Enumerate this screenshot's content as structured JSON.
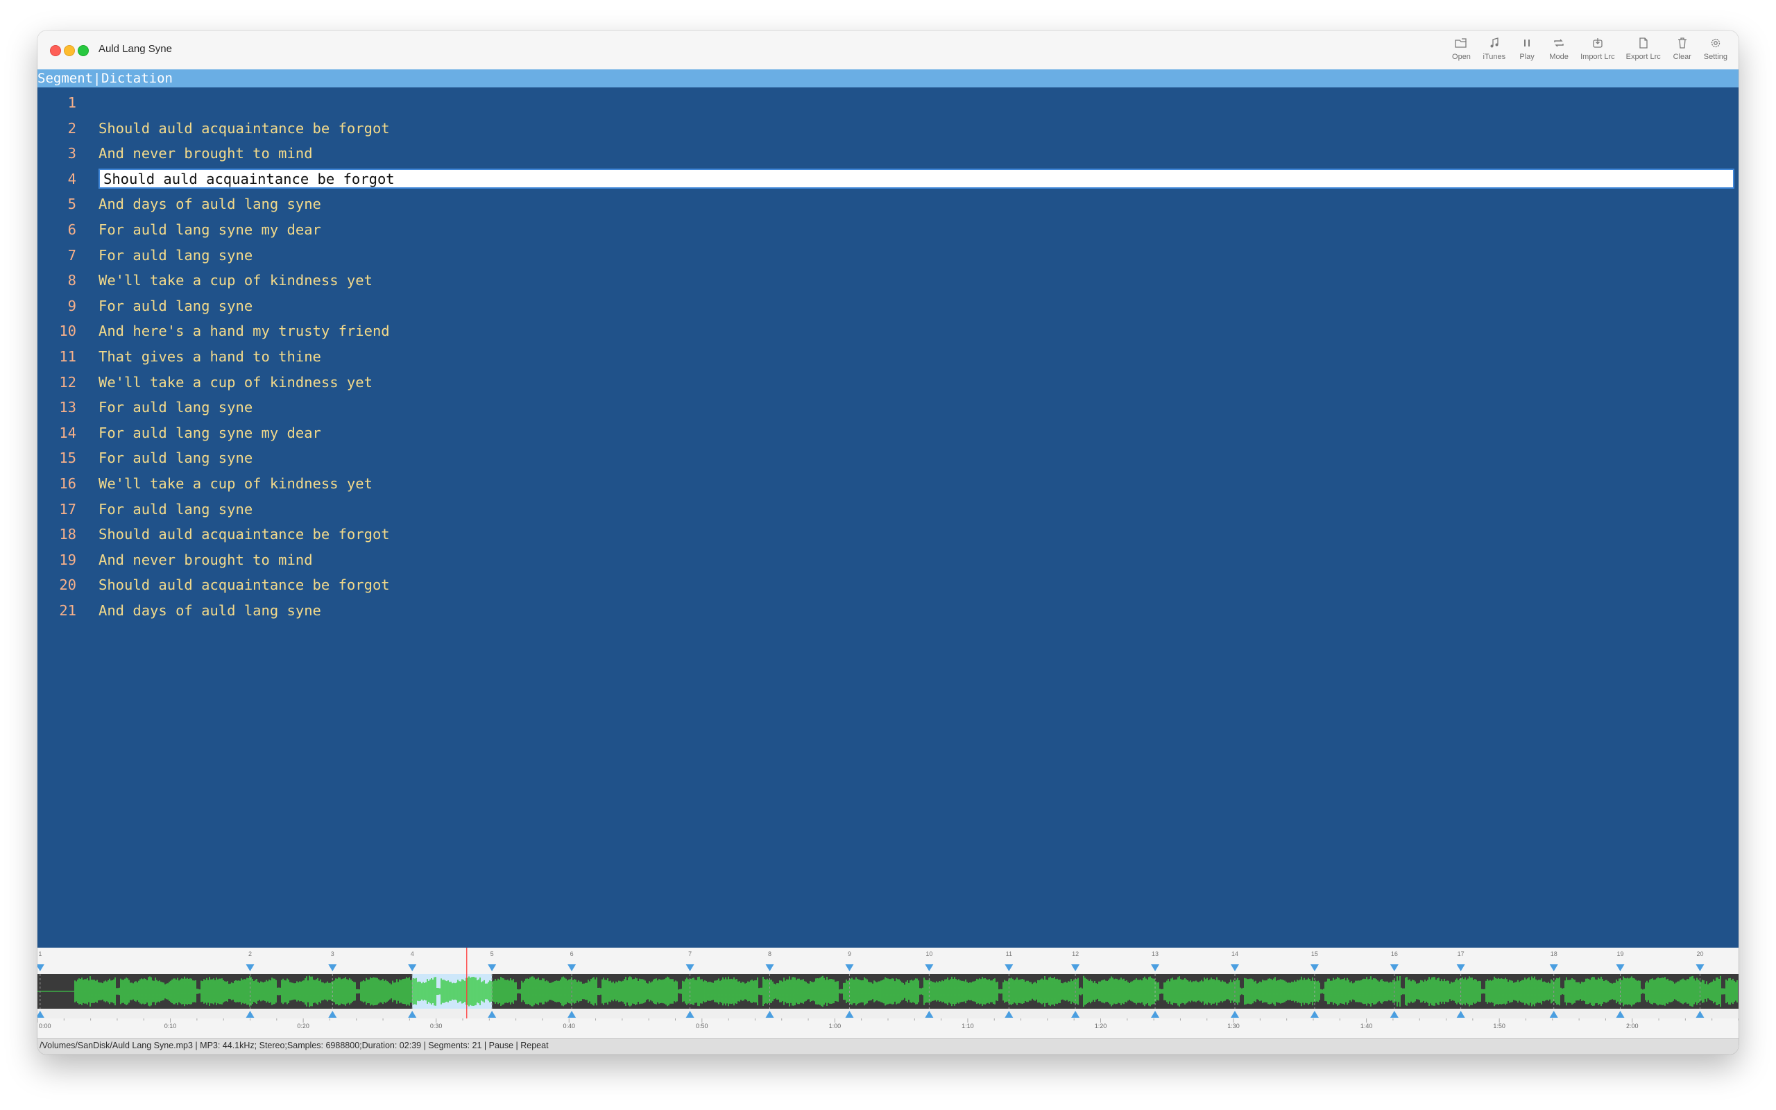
{
  "window": {
    "title": "Auld Lang Syne"
  },
  "toolbar": [
    {
      "name": "open",
      "label": "Open",
      "icon": "folder-open-icon"
    },
    {
      "name": "itunes",
      "label": "iTunes",
      "icon": "music-note-icon"
    },
    {
      "name": "play",
      "label": "Play",
      "icon": "pause-icon"
    },
    {
      "name": "mode",
      "label": "Mode",
      "icon": "repeat-icon"
    },
    {
      "name": "import-lrc",
      "label": "Import Lrc",
      "icon": "import-icon"
    },
    {
      "name": "export-lrc",
      "label": "Export Lrc",
      "icon": "document-icon"
    },
    {
      "name": "clear",
      "label": "Clear",
      "icon": "trash-icon"
    },
    {
      "name": "setting",
      "label": "Setting",
      "icon": "gear-icon"
    }
  ],
  "tabs": {
    "segment": "Segment",
    "separator": "|",
    "dictation": "Dictation"
  },
  "editor": {
    "active_line": 4,
    "lines": [
      {
        "n": "1",
        "text": ""
      },
      {
        "n": "2",
        "text": "Should auld acquaintance be forgot"
      },
      {
        "n": "3",
        "text": "And never brought to mind"
      },
      {
        "n": "4",
        "text": "Should auld acquaintance be forgot"
      },
      {
        "n": "5",
        "text": "And days of auld lang syne"
      },
      {
        "n": "6",
        "text": "For auld lang syne my dear"
      },
      {
        "n": "7",
        "text": "For auld lang syne"
      },
      {
        "n": "8",
        "text": "We'll take a cup of kindness yet"
      },
      {
        "n": "9",
        "text": "For auld lang syne"
      },
      {
        "n": "10",
        "text": "And here's a hand my trusty friend"
      },
      {
        "n": "11",
        "text": "That gives a hand to thine"
      },
      {
        "n": "12",
        "text": "We'll take a cup of kindness yet"
      },
      {
        "n": "13",
        "text": "For auld lang syne"
      },
      {
        "n": "14",
        "text": "For auld lang syne my dear"
      },
      {
        "n": "15",
        "text": "For auld lang syne"
      },
      {
        "n": "16",
        "text": "We'll take a cup of kindness yet"
      },
      {
        "n": "17",
        "text": "For auld lang syne"
      },
      {
        "n": "18",
        "text": "Should auld acquaintance be forgot"
      },
      {
        "n": "19",
        "text": "And never brought to mind"
      },
      {
        "n": "20",
        "text": "Should auld acquaintance be forgot"
      },
      {
        "n": "21",
        "text": "And days of auld lang syne"
      }
    ]
  },
  "waveform": {
    "duration_seconds": 159,
    "visible_seconds": 128,
    "playhead_seconds": 32.3,
    "selection_seconds": [
      28.2,
      34.2
    ],
    "markers": [
      {
        "label": "1",
        "t": 0.2
      },
      {
        "label": "2",
        "t": 16.0
      },
      {
        "label": "3",
        "t": 22.2
      },
      {
        "label": "4",
        "t": 28.2
      },
      {
        "label": "5",
        "t": 34.2
      },
      {
        "label": "6",
        "t": 40.2
      },
      {
        "label": "7",
        "t": 49.1
      },
      {
        "label": "8",
        "t": 55.1
      },
      {
        "label": "9",
        "t": 61.1
      },
      {
        "label": "10",
        "t": 67.1
      },
      {
        "label": "11",
        "t": 73.1
      },
      {
        "label": "12",
        "t": 78.1
      },
      {
        "label": "13",
        "t": 84.1
      },
      {
        "label": "14",
        "t": 90.1
      },
      {
        "label": "15",
        "t": 96.1
      },
      {
        "label": "16",
        "t": 102.1
      },
      {
        "label": "17",
        "t": 107.1
      },
      {
        "label": "18",
        "t": 114.1
      },
      {
        "label": "19",
        "t": 119.1
      },
      {
        "label": "20",
        "t": 125.1
      }
    ],
    "time_labels": [
      "0:00",
      "0:10",
      "0:20",
      "0:30",
      "0:40",
      "0:50",
      "1:00",
      "1:10",
      "1:20",
      "1:30",
      "1:40",
      "1:50",
      "2:00"
    ],
    "colors": {
      "wave": "#3fcc4a",
      "background": "#3a3a3a",
      "selection": "#cde7fa",
      "playhead": "#ff4040",
      "marker": "#4a9ee0"
    }
  },
  "status": {
    "text": "/Volumes/SanDisk/Auld Lang Syne.mp3 | MP3: 44.1kHz; Stereo;Samples: 6988800;Duration: 02:39 | Segments: 21 | Pause | Repeat"
  }
}
